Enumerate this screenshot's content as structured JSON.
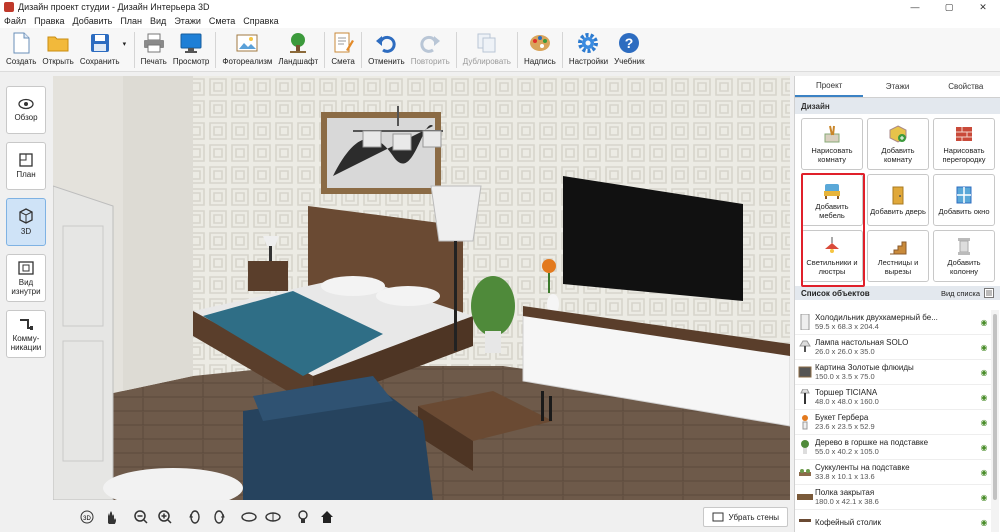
{
  "window": {
    "title": "Дизайн проект студии - Дизайн Интерьера 3D",
    "minimize": "—",
    "maximize": "▢",
    "close": "✕"
  },
  "menu": [
    "Файл",
    "Правка",
    "Добавить",
    "План",
    "Вид",
    "Этажи",
    "Смета",
    "Справка"
  ],
  "toolbar": {
    "create": "Создать",
    "open": "Открыть",
    "save": "Сохранить",
    "print": "Печать",
    "preview": "Просмотр",
    "photo": "Фотореализм",
    "landscape": "Ландшафт",
    "estimate": "Смета",
    "undo": "Отменить",
    "redo": "Повторить",
    "duplicate": "Дублировать",
    "labels": "Надпись",
    "settings": "Настройки",
    "tutorial": "Учебник"
  },
  "view_modes": {
    "overview": "Обзор",
    "plan": "План",
    "view3d": "3D",
    "inside": "Вид изнутри",
    "utilities": "Комму-никации"
  },
  "bottombar": {
    "remove_walls": "Убрать стены"
  },
  "panel": {
    "tabs": [
      "Проект",
      "Этажи",
      "Свойства"
    ],
    "design_header": "Дизайн",
    "design_buttons": [
      "Нарисовать комнату",
      "Добавить комнату",
      "Нарисовать перегородку",
      "Добавить мебель",
      "Добавить дверь",
      "Добавить окно",
      "Светильники и люстры",
      "Лестницы и вырезы",
      "Добавить колонну"
    ],
    "objects_header": "Список объектов",
    "list_view": "Вид списка",
    "objects": [
      {
        "name": "Холодильник двухкамерный бе...",
        "dims": "59.5 x 68.3 x 204.4"
      },
      {
        "name": "Лампа настольная SOLO",
        "dims": "26.0 x 26.0 x 35.0"
      },
      {
        "name": "Картина Золотые флюиды",
        "dims": "150.0 x 3.5 x 75.0"
      },
      {
        "name": "Торшер TICIANA",
        "dims": "48.0 x 48.0 x 160.0"
      },
      {
        "name": "Букет Гербера",
        "dims": "23.6 x 23.5 x 52.9"
      },
      {
        "name": "Дерево в горшке на подставке",
        "dims": "55.0 x 40.2 x 105.0"
      },
      {
        "name": "Суккуленты на подставке",
        "dims": "33.8 x 10.1 x 13.6"
      },
      {
        "name": "Полка закрытая",
        "dims": "180.0 x 42.1 x 38.6"
      },
      {
        "name": "Кофейный столик",
        "dims": ""
      }
    ]
  }
}
